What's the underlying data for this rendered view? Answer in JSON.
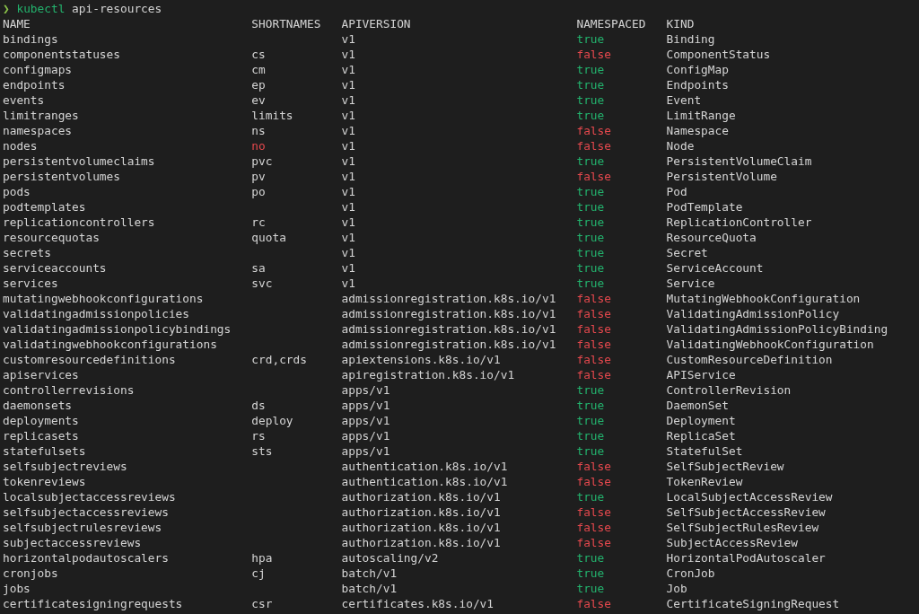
{
  "prompt": {
    "symbol": "❯",
    "command": "kubectl",
    "args": "api-resources"
  },
  "table": {
    "columns": [
      "NAME",
      "SHORTNAMES",
      "APIVERSION",
      "NAMESPACED",
      "KIND"
    ],
    "rows": [
      {
        "name": "bindings",
        "apiversion": "v1",
        "namespaced": "true",
        "namespaced_on": true,
        "kind": "Binding"
      },
      {
        "name": "componentstatuses",
        "shortnames": "cs",
        "apiversion": "v1",
        "namespaced": "false",
        "namespaced_on": false,
        "shortnames_alert": false,
        "kind": "ComponentStatus"
      },
      {
        "name": "configmaps",
        "shortnames": "cm",
        "apiversion": "v1",
        "namespaced": "true",
        "namespaced_on": true,
        "shortnames_alert": false,
        "kind": "ConfigMap"
      },
      {
        "name": "endpoints",
        "shortnames": "ep",
        "apiversion": "v1",
        "namespaced": "true",
        "namespaced_on": true,
        "shortnames_alert": false,
        "kind": "Endpoints"
      },
      {
        "name": "events",
        "shortnames": "ev",
        "apiversion": "v1",
        "namespaced": "true",
        "namespaced_on": true,
        "shortnames_alert": false,
        "kind": "Event"
      },
      {
        "name": "limitranges",
        "shortnames": "limits",
        "apiversion": "v1",
        "namespaced": "true",
        "namespaced_on": true,
        "shortnames_alert": false,
        "kind": "LimitRange"
      },
      {
        "name": "namespaces",
        "shortnames": "ns",
        "apiversion": "v1",
        "namespaced": "false",
        "namespaced_on": false,
        "shortnames_alert": false,
        "kind": "Namespace"
      },
      {
        "name": "nodes",
        "shortnames": "no",
        "apiversion": "v1",
        "namespaced": "false",
        "namespaced_on": false,
        "shortnames_alert": true,
        "kind": "Node"
      },
      {
        "name": "persistentvolumeclaims",
        "shortnames": "pvc",
        "apiversion": "v1",
        "namespaced": "true",
        "namespaced_on": true,
        "shortnames_alert": false,
        "kind": "PersistentVolumeClaim"
      },
      {
        "name": "persistentvolumes",
        "shortnames": "pv",
        "apiversion": "v1",
        "namespaced": "false",
        "namespaced_on": false,
        "shortnames_alert": false,
        "kind": "PersistentVolume"
      },
      {
        "name": "pods",
        "shortnames": "po",
        "apiversion": "v1",
        "namespaced": "true",
        "namespaced_on": true,
        "shortnames_alert": false,
        "kind": "Pod"
      },
      {
        "name": "podtemplates",
        "apiversion": "v1",
        "namespaced": "true",
        "namespaced_on": true,
        "kind": "PodTemplate"
      },
      {
        "name": "replicationcontrollers",
        "shortnames": "rc",
        "apiversion": "v1",
        "namespaced": "true",
        "namespaced_on": true,
        "shortnames_alert": false,
        "kind": "ReplicationController"
      },
      {
        "name": "resourcequotas",
        "shortnames": "quota",
        "apiversion": "v1",
        "namespaced": "true",
        "namespaced_on": true,
        "shortnames_alert": false,
        "kind": "ResourceQuota"
      },
      {
        "name": "secrets",
        "apiversion": "v1",
        "namespaced": "true",
        "namespaced_on": true,
        "kind": "Secret"
      },
      {
        "name": "serviceaccounts",
        "shortnames": "sa",
        "apiversion": "v1",
        "namespaced": "true",
        "namespaced_on": true,
        "shortnames_alert": false,
        "kind": "ServiceAccount"
      },
      {
        "name": "services",
        "shortnames": "svc",
        "apiversion": "v1",
        "namespaced": "true",
        "namespaced_on": true,
        "shortnames_alert": false,
        "kind": "Service"
      },
      {
        "name": "mutatingwebhookconfigurations",
        "apiversion": "admissionregistration.k8s.io/v1",
        "namespaced": "false",
        "namespaced_on": false,
        "kind": "MutatingWebhookConfiguration"
      },
      {
        "name": "validatingadmissionpolicies",
        "apiversion": "admissionregistration.k8s.io/v1",
        "namespaced": "false",
        "namespaced_on": false,
        "kind": "ValidatingAdmissionPolicy"
      },
      {
        "name": "validatingadmissionpolicybindings",
        "apiversion": "admissionregistration.k8s.io/v1",
        "namespaced": "false",
        "namespaced_on": false,
        "kind": "ValidatingAdmissionPolicyBinding"
      },
      {
        "name": "validatingwebhookconfigurations",
        "apiversion": "admissionregistration.k8s.io/v1",
        "namespaced": "false",
        "namespaced_on": false,
        "kind": "ValidatingWebhookConfiguration"
      },
      {
        "name": "customresourcedefinitions",
        "shortnames": "crd,crds",
        "apiversion": "apiextensions.k8s.io/v1",
        "namespaced": "false",
        "namespaced_on": false,
        "shortnames_alert": false,
        "kind": "CustomResourceDefinition"
      },
      {
        "name": "apiservices",
        "apiversion": "apiregistration.k8s.io/v1",
        "namespaced": "false",
        "namespaced_on": false,
        "kind": "APIService"
      },
      {
        "name": "controllerrevisions",
        "apiversion": "apps/v1",
        "namespaced": "true",
        "namespaced_on": true,
        "kind": "ControllerRevision"
      },
      {
        "name": "daemonsets",
        "shortnames": "ds",
        "apiversion": "apps/v1",
        "namespaced": "true",
        "namespaced_on": true,
        "shortnames_alert": false,
        "kind": "DaemonSet"
      },
      {
        "name": "deployments",
        "shortnames": "deploy",
        "apiversion": "apps/v1",
        "namespaced": "true",
        "namespaced_on": true,
        "shortnames_alert": false,
        "kind": "Deployment"
      },
      {
        "name": "replicasets",
        "shortnames": "rs",
        "apiversion": "apps/v1",
        "namespaced": "true",
        "namespaced_on": true,
        "shortnames_alert": false,
        "kind": "ReplicaSet"
      },
      {
        "name": "statefulsets",
        "shortnames": "sts",
        "apiversion": "apps/v1",
        "namespaced": "true",
        "namespaced_on": true,
        "shortnames_alert": false,
        "kind": "StatefulSet"
      },
      {
        "name": "selfsubjectreviews",
        "apiversion": "authentication.k8s.io/v1",
        "namespaced": "false",
        "namespaced_on": false,
        "kind": "SelfSubjectReview"
      },
      {
        "name": "tokenreviews",
        "apiversion": "authentication.k8s.io/v1",
        "namespaced": "false",
        "namespaced_on": false,
        "kind": "TokenReview"
      },
      {
        "name": "localsubjectaccessreviews",
        "apiversion": "authorization.k8s.io/v1",
        "namespaced": "true",
        "namespaced_on": true,
        "kind": "LocalSubjectAccessReview"
      },
      {
        "name": "selfsubjectaccessreviews",
        "apiversion": "authorization.k8s.io/v1",
        "namespaced": "false",
        "namespaced_on": false,
        "kind": "SelfSubjectAccessReview"
      },
      {
        "name": "selfsubjectrulesreviews",
        "apiversion": "authorization.k8s.io/v1",
        "namespaced": "false",
        "namespaced_on": false,
        "kind": "SelfSubjectRulesReview"
      },
      {
        "name": "subjectaccessreviews",
        "apiversion": "authorization.k8s.io/v1",
        "namespaced": "false",
        "namespaced_on": false,
        "kind": "SubjectAccessReview"
      },
      {
        "name": "horizontalpodautoscalers",
        "shortnames": "hpa",
        "apiversion": "autoscaling/v2",
        "namespaced": "true",
        "namespaced_on": true,
        "shortnames_alert": false,
        "kind": "HorizontalPodAutoscaler"
      },
      {
        "name": "cronjobs",
        "shortnames": "cj",
        "apiversion": "batch/v1",
        "namespaced": "true",
        "namespaced_on": true,
        "shortnames_alert": false,
        "kind": "CronJob"
      },
      {
        "name": "jobs",
        "apiversion": "batch/v1",
        "namespaced": "true",
        "namespaced_on": true,
        "kind": "Job"
      },
      {
        "name": "certificatesigningrequests",
        "shortnames": "csr",
        "apiversion": "certificates.k8s.io/v1",
        "namespaced": "false",
        "namespaced_on": false,
        "shortnames_alert": false,
        "kind": "CertificateSigningRequest"
      }
    ]
  }
}
